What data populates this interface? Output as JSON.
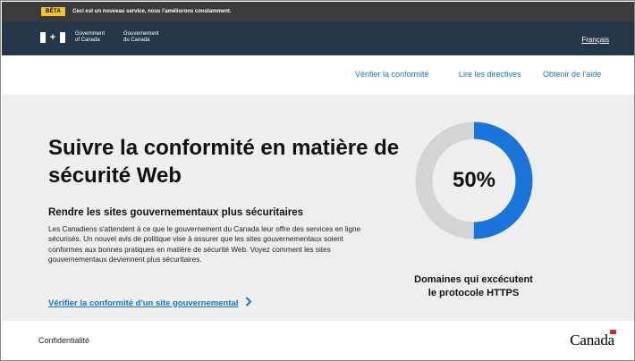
{
  "beta": {
    "badge": "BÊTA",
    "message": "Ceci est un nouveau service, nous l'améliorons constamment."
  },
  "header": {
    "signature_en_line1": "Government",
    "signature_en_line2": "of Canada",
    "signature_fr_line1": "Gouvernement",
    "signature_fr_line2": "du Canada",
    "language_link": "Français"
  },
  "nav": {
    "items": [
      {
        "label": "Vérifier la conformité"
      },
      {
        "label": "Lire les directives"
      },
      {
        "label": "Obtenir de l'aide"
      }
    ]
  },
  "hero": {
    "title": "Suivre la conformité en matière de sécurité Web",
    "subtitle": "Rendre les sites gouvernementaux plus sécuritaires",
    "body": "Les Canadiens s'attendent à ce que le gouvernement du Canada leur offre des services en ligne sécurisés. Un nouvel avis de politique vise à assurer que les sites gouvernementaux soient conformes aux bonnes pratiques en matière de sécurité Web. Voyez comment les sites gouvernementaux deviennent plus sécuritaires.",
    "cta": "Vérifier la conformité d'un site gouvernemental"
  },
  "stat": {
    "percent_label": "50%",
    "fraction": 0.5,
    "caption_line1": "Domaines qui excécutent",
    "caption_line2": "le protocole HTTPS",
    "fill_color": "#1a74d9",
    "track_color": "#d4d4d4"
  },
  "footer": {
    "privacy": "Confidentialité",
    "wordmark": "Canada"
  }
}
